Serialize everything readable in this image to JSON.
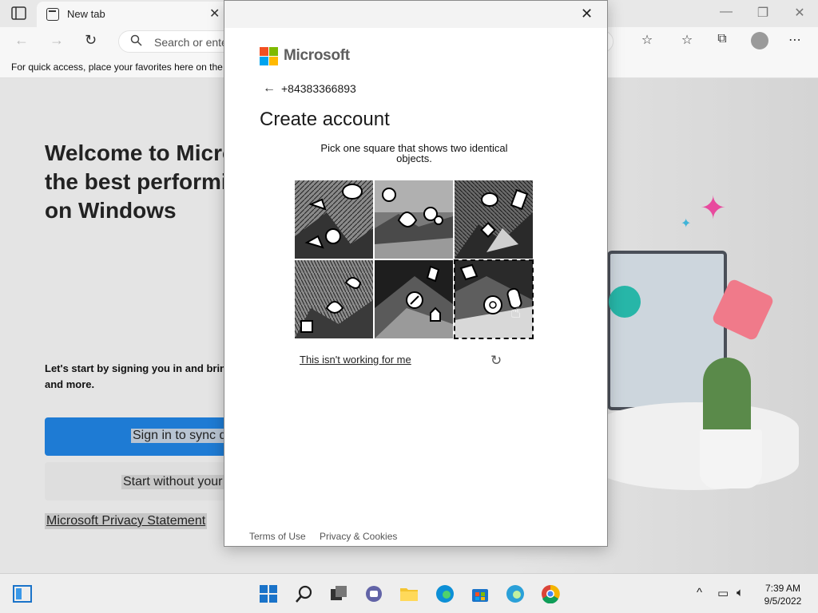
{
  "browser": {
    "tab_title": "New tab",
    "tab_close": "✕",
    "search_placeholder": "Search or ente",
    "favorites_hint": "For quick access, place your favorites here on the",
    "minimize": "—",
    "restore": "❐",
    "close": "✕",
    "back": "←",
    "forward": "→",
    "refresh": "↻",
    "more": "⋯"
  },
  "page": {
    "welcome": "Welcome to Microsoft Edge, the best performing browser on Windows",
    "lets_start": "Let's start by signing you in and bringing your passwords, history, and more.",
    "signin_button": "Sign in to sync d",
    "start_button": "Start without your",
    "privacy_link": "Microsoft Privacy Statement"
  },
  "dialog": {
    "close": "✕",
    "brand": "Microsoft",
    "back": "←",
    "phone": "+84383366893",
    "heading": "Create account",
    "instructions": "Pick one square that shows two identical objects.",
    "not_working_link": "This isn't working for me",
    "spinner": "↻",
    "footer": {
      "terms": "Terms of Use",
      "privacy": "Privacy & Cookies"
    },
    "puzzle_tiles": [
      {
        "index": 1,
        "selected": false
      },
      {
        "index": 2,
        "selected": false
      },
      {
        "index": 3,
        "selected": false
      },
      {
        "index": 4,
        "selected": false
      },
      {
        "index": 5,
        "selected": false
      },
      {
        "index": 6,
        "selected": true
      }
    ]
  },
  "taskbar": {
    "time": "7:39 AM",
    "date": "9/5/2022",
    "tray_chevron": "^",
    "colors": {
      "start": "#1a73c9",
      "edge": "#0c8fd6",
      "chrome_red": "#db4437",
      "chrome_yellow": "#f4b400",
      "chrome_green": "#0f9d58"
    }
  },
  "brand_colors": {
    "ms_red": "#f25022",
    "ms_green": "#7fba00",
    "ms_blue": "#00a4ef",
    "ms_yellow": "#ffb900",
    "signin_blue": "#1e7bd4"
  }
}
